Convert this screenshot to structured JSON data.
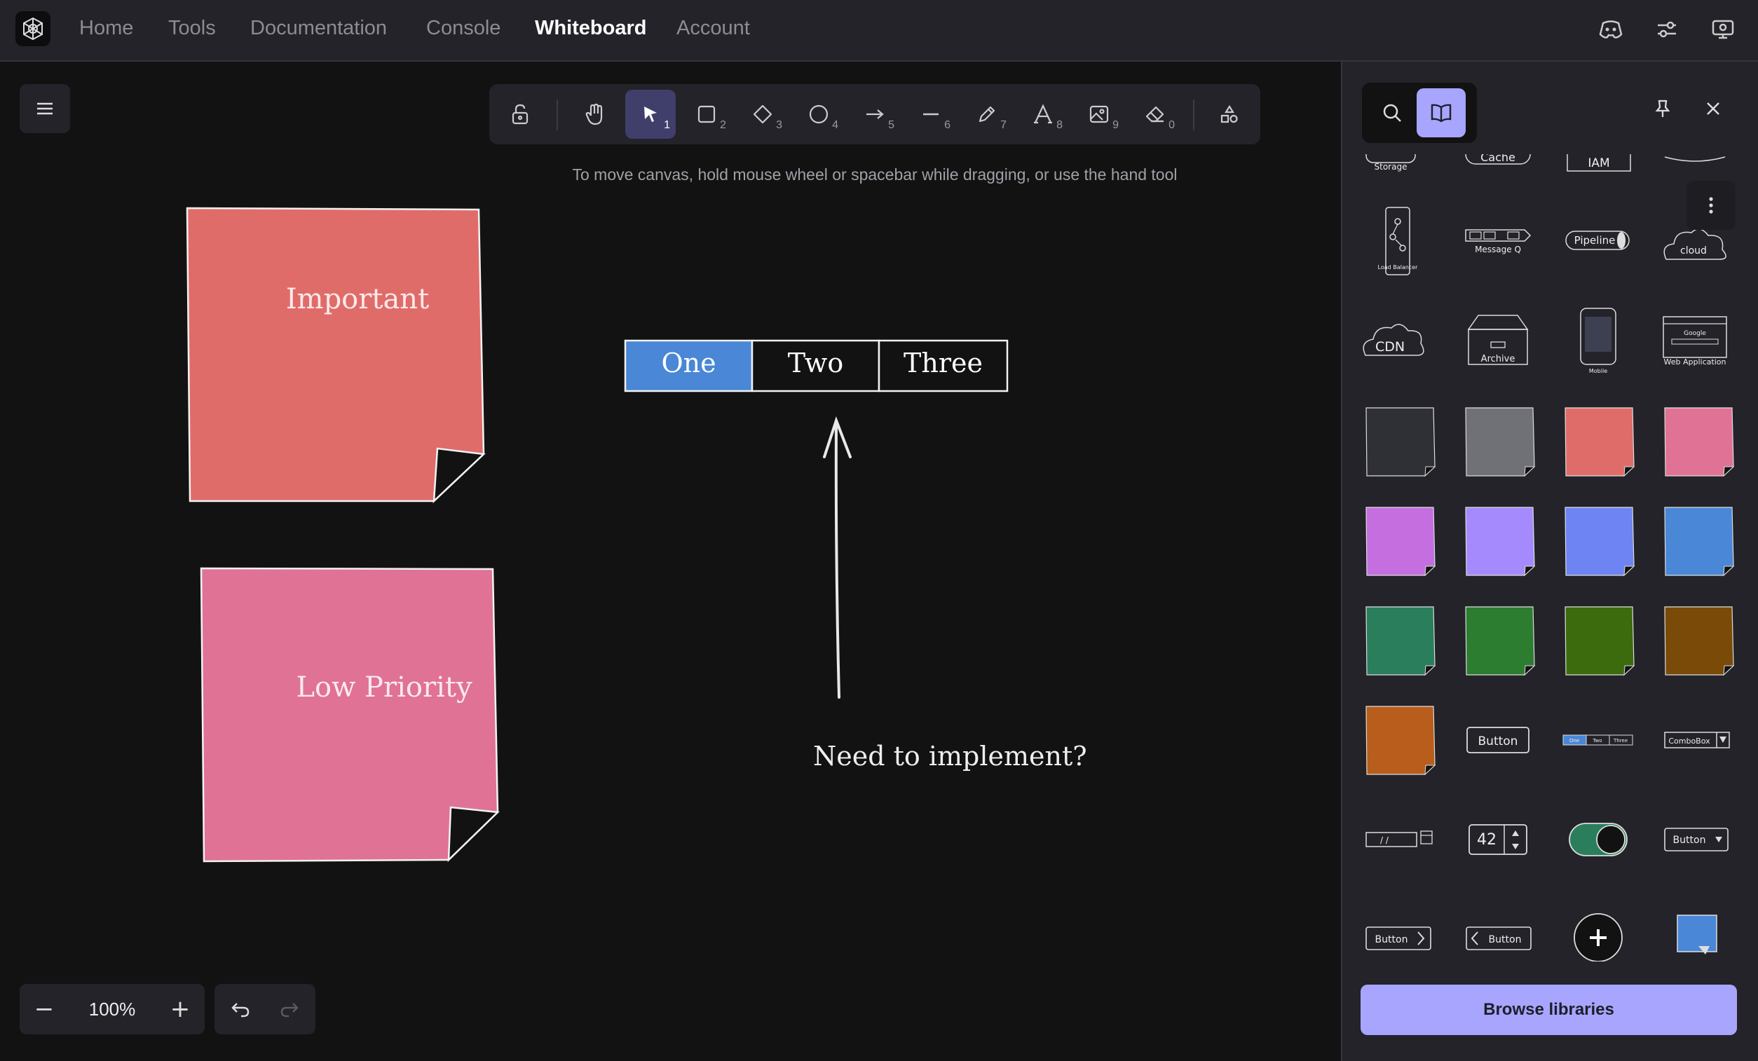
{
  "nav": {
    "items": [
      "Home",
      "Tools",
      "Documentation",
      "Console",
      "Whiteboard",
      "Account"
    ],
    "active": "Whiteboard",
    "right_icons": [
      "discord-icon",
      "sliders-icon",
      "monitor-icon"
    ]
  },
  "toolbar": {
    "tools": [
      {
        "name": "lock",
        "shortcut": ""
      },
      {
        "name": "hand",
        "shortcut": ""
      },
      {
        "name": "selection",
        "shortcut": "1"
      },
      {
        "name": "rectangle",
        "shortcut": "2"
      },
      {
        "name": "diamond",
        "shortcut": "3"
      },
      {
        "name": "ellipse",
        "shortcut": "4"
      },
      {
        "name": "arrow",
        "shortcut": "5"
      },
      {
        "name": "line",
        "shortcut": "6"
      },
      {
        "name": "draw",
        "shortcut": "7"
      },
      {
        "name": "text",
        "shortcut": "8"
      },
      {
        "name": "image",
        "shortcut": "9"
      },
      {
        "name": "eraser",
        "shortcut": "0"
      },
      {
        "name": "more-shapes",
        "shortcut": ""
      }
    ],
    "selected": "selection",
    "selected_color": "#403e6a"
  },
  "hint": "To move canvas, hold mouse wheel or spacebar while dragging, or use the hand tool",
  "canvas": {
    "sticky_important": {
      "label": "Important",
      "color": "#e06c6a"
    },
    "sticky_low": {
      "label": "Low Priority",
      "color": "#e07296"
    },
    "tabs_widget": {
      "tabs": [
        "One",
        "Two",
        "Three"
      ],
      "active": "One",
      "active_color": "#4a87d6"
    },
    "arrow_note": "Need to implement?"
  },
  "zoom": {
    "minus": "−",
    "value": "100%",
    "plus": "+"
  },
  "history": {
    "undo_icon": "undo-icon",
    "redo_icon": "redo-icon"
  },
  "panel": {
    "tabs": [
      "search",
      "library"
    ],
    "active_tab": "library",
    "active_color": "#a8a5ff",
    "library_labels": {
      "storage": "Storage",
      "cache": "Cache",
      "iam": "IAM",
      "load_balancer": "Load Balancer",
      "message_q": "Message Q",
      "pipeline": "Pipeline",
      "cloud": "cloud",
      "cdn": "CDN",
      "archive": "Archive",
      "mobile": "Mobile",
      "web_app": "Web Application",
      "google": "Google",
      "button": "Button",
      "combobox": "ComboBox",
      "stepper": "42",
      "date": "/ /",
      "tabs_mini": [
        "One",
        "Two",
        "Three"
      ]
    },
    "sticky_colors": [
      "#2f3036",
      "#6f7177",
      "#e06c6a",
      "#e07296",
      "#c56ee0",
      "#a58afe",
      "#6e84f2",
      "#4a87d6",
      "#2a7e5c",
      "#2c7d2f",
      "#3b6b0d",
      "#7a4b08",
      "#b85d1c"
    ],
    "browse_label": "Browse libraries"
  }
}
